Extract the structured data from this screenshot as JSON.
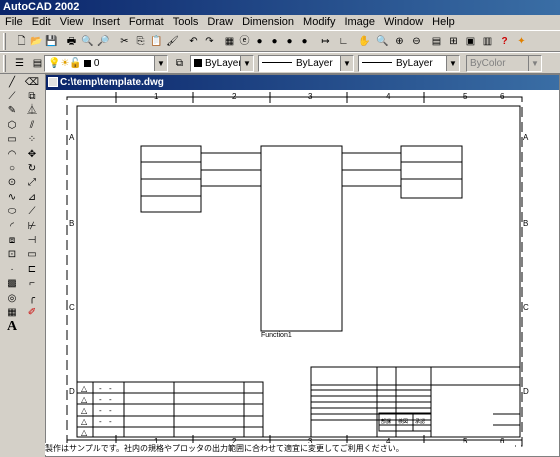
{
  "app": {
    "title": "AutoCAD 2002"
  },
  "menu": [
    "File",
    "Edit",
    "View",
    "Insert",
    "Format",
    "Tools",
    "Draw",
    "Dimension",
    "Modify",
    "Image",
    "Window",
    "Help"
  ],
  "layers": {
    "current_layer": "0",
    "color": "ByLayer",
    "linetype": "ByLayer",
    "lineweight": "ByLayer",
    "plotstyle": "ByColor"
  },
  "document": {
    "title": "C:\\temp\\template.dwg"
  },
  "drawing": {
    "col_labels": [
      "1",
      "2",
      "3",
      "4",
      "5",
      "6"
    ],
    "row_labels": [
      "A",
      "B",
      "C",
      "D"
    ],
    "function_label": "Function1",
    "revision_rows": [
      [
        "-",
        "-"
      ],
      [
        "-",
        "-"
      ],
      [
        "-",
        "-"
      ],
      [
        "-",
        "-"
      ]
    ],
    "revision_symbol": "△",
    "title_block_labels": [
      "部課",
      "検図",
      "承認"
    ]
  },
  "status": {
    "note": "製作はサンプルです。社内の規格やプロッタの出力範囲に合わせて適宜に変更してご利用ください。"
  },
  "icons": {
    "toolbar1": [
      "new-icon",
      "open-icon",
      "save-icon",
      "print-icon",
      "preview-icon",
      "find-icon",
      "cut-icon",
      "copy-icon",
      "paste-icon",
      "matchprop-icon",
      "undo-icon",
      "redo-icon",
      "dbconnect-icon",
      "web-icon",
      "ball1-icon",
      "ball2-icon",
      "ball3-icon",
      "ball4-icon",
      "distance-icon",
      "ucs-icon",
      "pan-icon",
      "zoom-realtime-icon",
      "zoom-window-icon",
      "zoom-prev-icon",
      "properties-icon",
      "designcenter-icon",
      "help-icon",
      "brush-icon"
    ],
    "draw": [
      "line-icon",
      "xline-icon",
      "pline-icon",
      "polygon-icon",
      "rectang-icon",
      "arc-icon",
      "circle-icon",
      "revcloud-icon",
      "spline-icon",
      "ellipse-icon",
      "insert-block-icon",
      "make-block-icon",
      "point-icon",
      "hatch-icon",
      "region-icon",
      "mtext-icon"
    ],
    "modify": [
      "erase-icon",
      "copy-obj-icon",
      "mirror-icon",
      "offset-icon",
      "array-icon",
      "move-icon",
      "rotate-icon",
      "scale-icon",
      "stretch-icon",
      "trim-icon",
      "extend-icon",
      "break-icon",
      "join-icon",
      "chamfer-icon",
      "fillet-icon",
      "explode-icon"
    ]
  }
}
